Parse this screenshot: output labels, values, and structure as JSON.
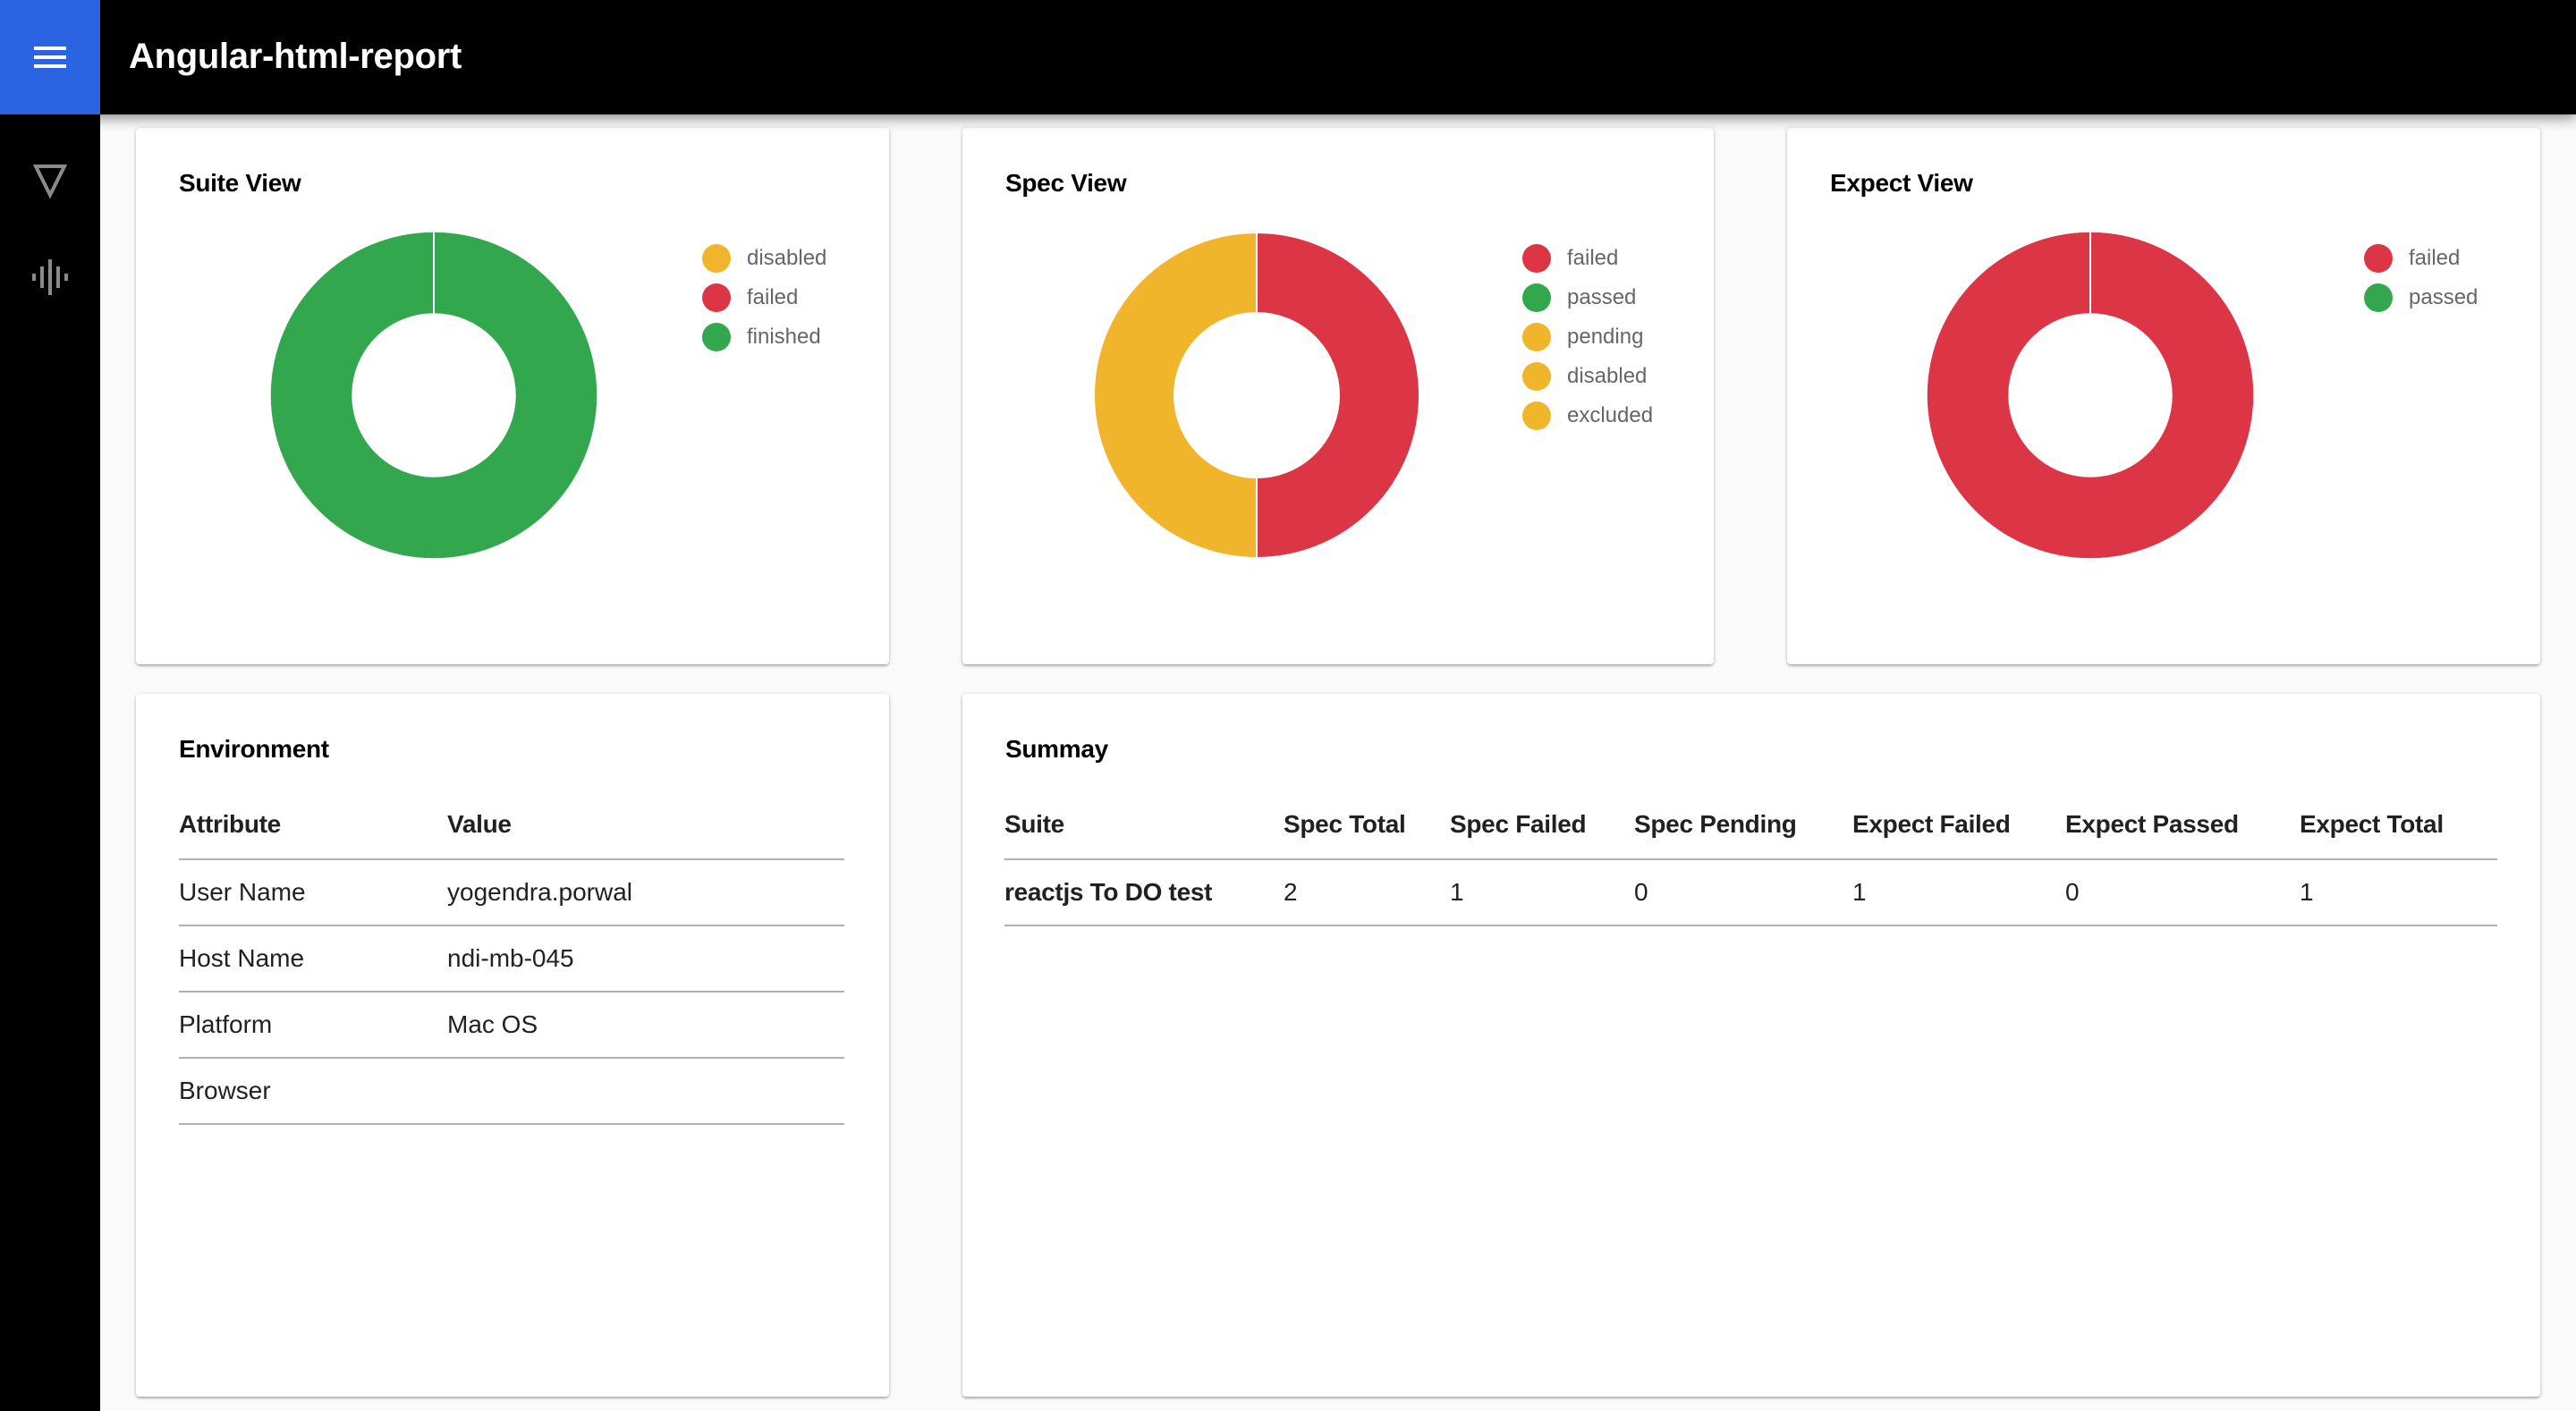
{
  "app": {
    "title": "Angular-html-report",
    "menu_icon": "hamburger-menu-icon",
    "brand_color": "#2b64e3"
  },
  "sidebar": {
    "items": [
      {
        "icon": "triangle-down-icon",
        "name": "sidebar-item-filter"
      },
      {
        "icon": "waveform-icon",
        "name": "sidebar-item-activity"
      }
    ]
  },
  "colors": {
    "failed": "#dc3545",
    "passed": "#32a74d",
    "finished": "#32a74d",
    "pending": "#f1b52c",
    "disabled": "#f1b52c",
    "excluded": "#f1b52c"
  },
  "chart_data": [
    {
      "type": "pie",
      "variant": "doughnut",
      "title": "Suite View",
      "labels": [
        "disabled",
        "failed",
        "finished"
      ],
      "values": [
        0,
        0,
        1
      ],
      "colors": [
        "#f1b52c",
        "#dc3545",
        "#32a74d"
      ],
      "legend": "right"
    },
    {
      "type": "pie",
      "variant": "doughnut",
      "title": "Spec View",
      "labels": [
        "failed",
        "passed",
        "pending",
        "disabled",
        "excluded"
      ],
      "values": [
        1,
        0,
        0,
        0,
        1
      ],
      "colors": [
        "#dc3545",
        "#32a74d",
        "#f1b52c",
        "#f1b52c",
        "#f1b52c"
      ],
      "legend": "right"
    },
    {
      "type": "pie",
      "variant": "doughnut",
      "title": "Expect View",
      "labels": [
        "failed",
        "passed"
      ],
      "values": [
        1,
        0
      ],
      "colors": [
        "#dc3545",
        "#32a74d"
      ],
      "legend": "right"
    }
  ],
  "environment": {
    "title": "Environment",
    "headers": [
      "Attribute",
      "Value"
    ],
    "rows": [
      [
        "User Name",
        "yogendra.porwal"
      ],
      [
        "Host Name",
        "ndi-mb-045"
      ],
      [
        "Platform",
        "Mac OS"
      ],
      [
        "Browser",
        ""
      ]
    ]
  },
  "summary": {
    "title": "Summay",
    "headers": [
      "Suite",
      "Spec Total",
      "Spec Failed",
      "Spec Pending",
      "Expect Failed",
      "Expect Passed",
      "Expect Total"
    ],
    "rows": [
      [
        "reactjs To DO test",
        "2",
        "1",
        "0",
        "1",
        "0",
        "1"
      ]
    ]
  }
}
